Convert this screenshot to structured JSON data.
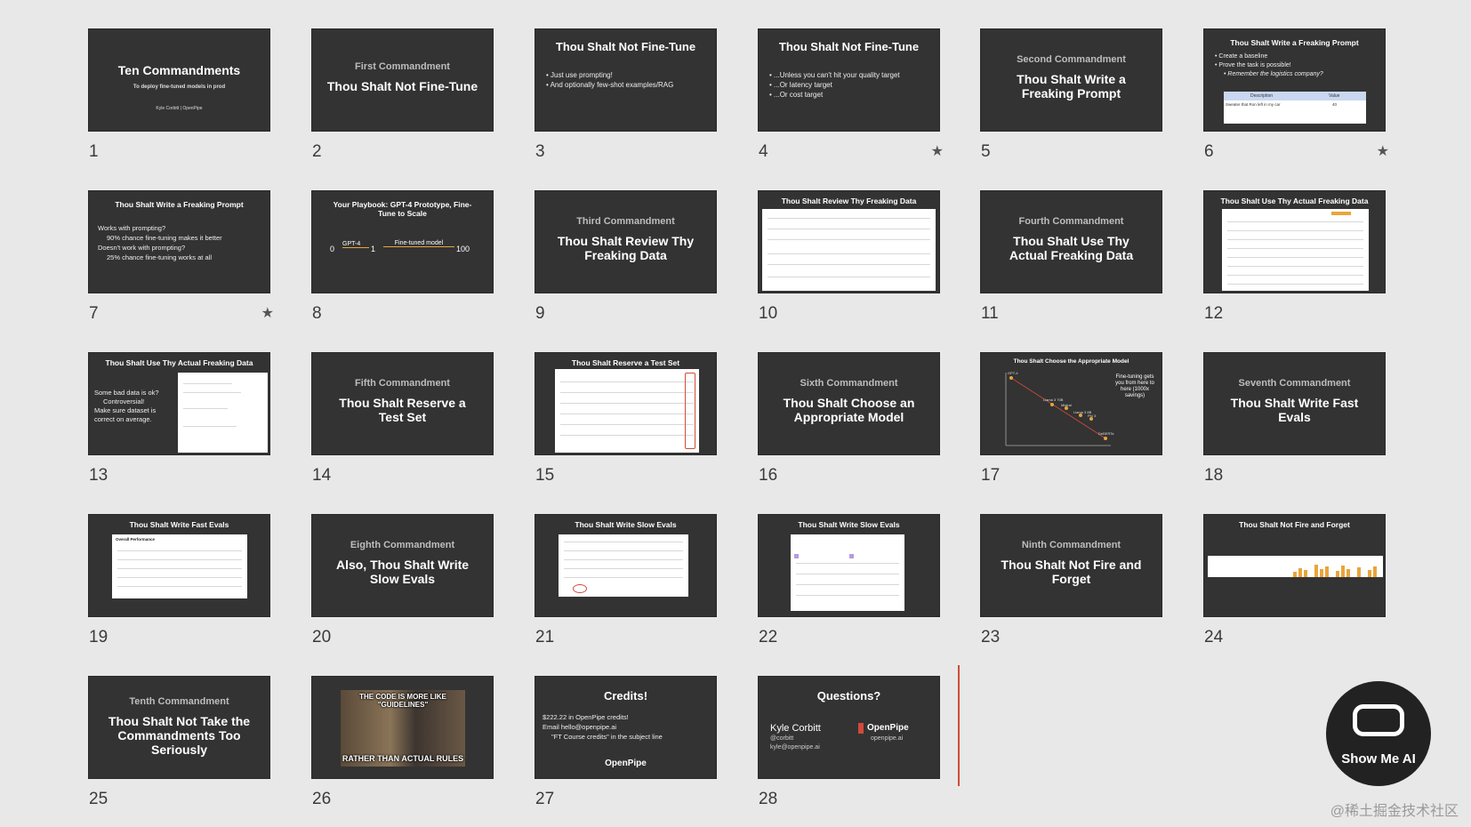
{
  "slides": [
    {
      "number": "1",
      "title": "Ten Commandments",
      "subtitle": "To deploy fine-tuned models in prod",
      "footer": "Kyle Corbitt | OpenPipe"
    },
    {
      "number": "2",
      "kicker": "First Commandment",
      "title": "Thou Shalt Not Fine-Tune"
    },
    {
      "number": "3",
      "title": "Thou Shalt Not Fine-Tune",
      "bullets": [
        "Just use prompting!",
        "And optionally few-shot examples/RAG"
      ]
    },
    {
      "number": "4",
      "title": "Thou Shalt Not Fine-Tune",
      "bullets": [
        "...Unless you can't hit your quality target",
        "...Or latency target",
        "...Or cost target"
      ],
      "star": "★"
    },
    {
      "number": "5",
      "kicker": "Second Commandment",
      "title": "Thou Shalt Write a Freaking Prompt"
    },
    {
      "number": "6",
      "title": "Thou Shalt Write a Freaking Prompt",
      "bullets": [
        "Create a baseline",
        "Prove the task is possible!",
        "Remember the logistics company?"
      ],
      "table_headers": [
        "Description",
        "Value"
      ],
      "table_row": [
        "Sweater that Ron left in my car",
        "40"
      ],
      "star": "★"
    },
    {
      "number": "7",
      "title": "Thou Shalt Write a Freaking Prompt",
      "bullets": [
        "Works with prompting?",
        "90% chance fine-tuning makes it better",
        "Doesn't work with prompting?",
        "25% chance fine-tuning works at all"
      ],
      "star": "★"
    },
    {
      "number": "8",
      "title": "Your Playbook: GPT-4 Prototype, Fine-Tune to Scale",
      "axis": [
        "0",
        "GPT-4",
        "1",
        "Fine-tuned model",
        "100"
      ]
    },
    {
      "number": "9",
      "kicker": "Third Commandment",
      "title": "Thou Shalt Review Thy Freaking Data"
    },
    {
      "number": "10",
      "title": "Thou Shalt Review Thy Freaking Data"
    },
    {
      "number": "11",
      "kicker": "Fourth Commandment",
      "title": "Thou Shalt Use Thy Actual Freaking Data"
    },
    {
      "number": "12",
      "title": "Thou Shalt Use Thy Actual Freaking Data"
    },
    {
      "number": "13",
      "title": "Thou Shalt Use Thy Actual Freaking Data",
      "bullets": [
        "Some bad data is ok?",
        "Controversial!",
        "Make sure dataset is correct on average."
      ]
    },
    {
      "number": "14",
      "kicker": "Fifth Commandment",
      "title": "Thou Shalt Reserve a Test Set"
    },
    {
      "number": "15",
      "title": "Thou Shalt Reserve a Test Set"
    },
    {
      "number": "16",
      "kicker": "Sixth Commandment",
      "title": "Thou Shalt Choose an Appropriate Model"
    },
    {
      "number": "17",
      "title": "Thou Shalt Choose the Appropriate Model",
      "note": "Fine-tuning gets you from here to here (1000x savings)",
      "points": [
        "GPT-4",
        "Llama 3 70B",
        "Mistral",
        "Llama 3 8B",
        "Phi 3",
        "DeBERTa"
      ]
    },
    {
      "number": "18",
      "kicker": "Seventh Commandment",
      "title": "Thou Shalt Write Fast Evals"
    },
    {
      "number": "19",
      "title": "Thou Shalt Write Fast Evals",
      "panel": "Overall Performance"
    },
    {
      "number": "20",
      "kicker": "Eighth Commandment",
      "title": "Also, Thou Shalt Write Slow Evals"
    },
    {
      "number": "21",
      "title": "Thou Shalt Write Slow Evals"
    },
    {
      "number": "22",
      "title": "Thou Shalt Write Slow Evals"
    },
    {
      "number": "23",
      "kicker": "Ninth Commandment",
      "title": "Thou Shalt Not Fire and Forget"
    },
    {
      "number": "24",
      "title": "Thou Shalt Not Fire and Forget"
    },
    {
      "number": "25",
      "kicker": "Tenth Commandment",
      "title": "Thou Shalt Not Take the Commandments Too Seriously"
    },
    {
      "number": "26",
      "meme_top": "THE CODE IS MORE LIKE \"GUIDELINES\"",
      "meme_bottom": "RATHER THAN ACTUAL RULES"
    },
    {
      "number": "27",
      "title": "Credits!",
      "bullets": [
        "$222.22 in OpenPipe credits!",
        "Email hello@openpipe.ai",
        "\"FT Course credits\" in the subject line"
      ],
      "footer": "OpenPipe"
    },
    {
      "number": "28",
      "title": "Questions?",
      "name": "Kyle Corbitt",
      "handle": "@corbitt",
      "email": "kyle@openpipe.ai",
      "brand": "OpenPipe",
      "site": "openpipe.ai"
    }
  ],
  "logo_text": "Show Me AI",
  "watermark": "@稀土掘金技术社区",
  "colors": {
    "background": "#e8e8e8",
    "slide": "#333333",
    "accent": "#d14a3a",
    "orange": "#e9a53a"
  }
}
